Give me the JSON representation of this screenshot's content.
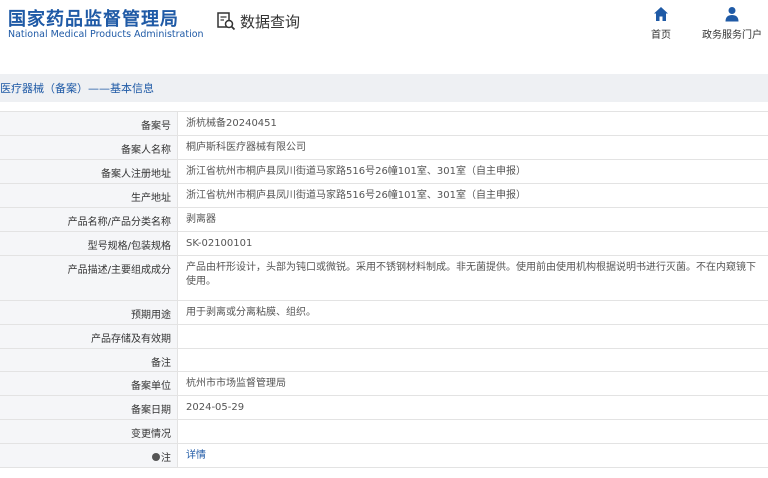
{
  "header": {
    "logo_cn": "国家药品监督管理局",
    "logo_en": "National Medical Products Administration",
    "query_label": "数据查询",
    "nav_home": "首页",
    "nav_portal": "政务服务门户"
  },
  "section": {
    "title": "医疗器械（备案）——基本信息"
  },
  "rows": [
    {
      "label": "备案号",
      "value": "浙杭械备20240451"
    },
    {
      "label": "备案人名称",
      "value": "桐庐斯科医疗器械有限公司"
    },
    {
      "label": "备案人注册地址",
      "value": "浙江省杭州市桐庐县凤川街道马家路516号26幢101室、301室（自主申报）"
    },
    {
      "label": "生产地址",
      "value": "浙江省杭州市桐庐县凤川街道马家路516号26幢101室、301室（自主申报）"
    },
    {
      "label": "产品名称/产品分类名称",
      "value": "剥离器"
    },
    {
      "label": "型号规格/包装规格",
      "value": "SK-02100101"
    },
    {
      "label": "产品描述/主要组成成分",
      "value": "产品由杆形设计，头部为钝口或微锐。采用不锈钢材料制成。非无菌提供。使用前由使用机构根据说明书进行灭菌。不在内窥镜下使用。"
    },
    {
      "label": "预期用途",
      "value": "用于剥离或分离粘膜、组织。"
    },
    {
      "label": "产品存储及有效期",
      "value": ""
    },
    {
      "label": "备注",
      "value": ""
    },
    {
      "label": "备案单位",
      "value": "杭州市市场监督管理局"
    },
    {
      "label": "备案日期",
      "value": "2024-05-29"
    },
    {
      "label": "变更情况",
      "value": ""
    },
    {
      "label": "注",
      "value": "详情"
    }
  ]
}
